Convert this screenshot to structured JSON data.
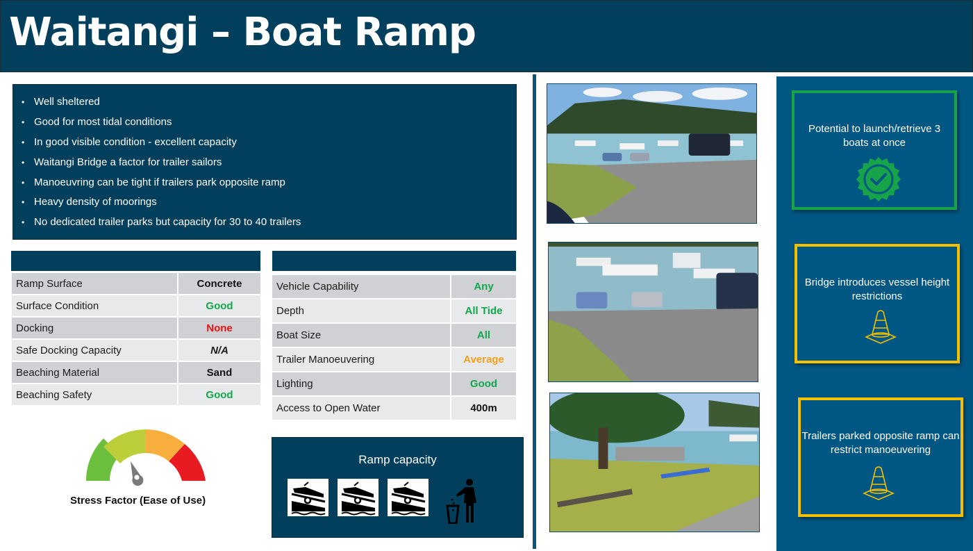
{
  "header": {
    "title": "Waitangi – Boat Ramp"
  },
  "colors": {
    "navy": "#023f5c",
    "panel_blue": "#005783",
    "good_green": "#10a84b",
    "bad_red": "#ee1111",
    "average_orange": "#f5a01c",
    "warning_yellow": "#f5c000",
    "callout_green": "#16a34a"
  },
  "features": {
    "items": [
      "Well sheltered",
      "Good for most tidal conditions",
      "In good visible condition - excellent capacity",
      "Waitangi Bridge a factor for trailer sailors",
      "Manoeuvring can be tight if trailers park opposite ramp",
      "Heavy density of moorings",
      "No dedicated trailer parks but capacity for 30 to 40 trailers"
    ]
  },
  "ramp_table": {
    "header": "",
    "rows": [
      {
        "label": "Ramp Surface",
        "value": "Concrete",
        "status": "plain-bold"
      },
      {
        "label": "Surface Condition",
        "value": "Good",
        "status": "good"
      },
      {
        "label": "Docking",
        "value": "None",
        "status": "bad"
      },
      {
        "label": "Safe Docking Capacity",
        "value": "N/A",
        "status": "na"
      },
      {
        "label": "Beaching Material",
        "value": "Sand",
        "status": "plain-bold"
      },
      {
        "label": "Beaching Safety",
        "value": "Good",
        "status": "good"
      }
    ]
  },
  "access_table": {
    "header": "",
    "rows": [
      {
        "label": "Vehicle Capability",
        "value": "Any",
        "status": "good"
      },
      {
        "label": "Depth",
        "value": "All Tide",
        "status": "good"
      },
      {
        "label": "Boat Size",
        "value": "All",
        "status": "good"
      },
      {
        "label": "Trailer Manoeuvering",
        "value": "Average",
        "status": "average"
      },
      {
        "label": "Lighting",
        "value": "Good",
        "status": "good"
      },
      {
        "label": "Access to Open Water",
        "value": "400m",
        "status": "plain"
      }
    ]
  },
  "stress_gauge": {
    "label": "Stress Factor (Ease of Use)",
    "segments": [
      "green",
      "yellow-green",
      "orange",
      "red"
    ],
    "needle_fraction": 0.42
  },
  "ramp_capacity": {
    "title": "Ramp capacity",
    "ramp_count": 3,
    "icons": [
      "boat-ramp-icon",
      "boat-ramp-icon",
      "boat-ramp-icon",
      "litter-bin-icon"
    ]
  },
  "photos": [
    {
      "name": "photo-ramp-overview",
      "description": "Boat ramp with moorings and hills"
    },
    {
      "name": "photo-ramp-launching",
      "description": "Cars launching boats at ramp"
    },
    {
      "name": "photo-ramp-shore",
      "description": "Shoreline with tree and trailer"
    }
  ],
  "callouts": [
    {
      "text": "Potential to launch/retrieve 3 boats at once",
      "icon": "check-badge-icon",
      "tone": "positive"
    },
    {
      "text": "Bridge introduces vessel height restrictions",
      "icon": "traffic-cone-icon",
      "tone": "warning"
    },
    {
      "text": "Trailers parked opposite ramp can restrict manoeuvering",
      "icon": "traffic-cone-icon",
      "tone": "warning"
    }
  ]
}
